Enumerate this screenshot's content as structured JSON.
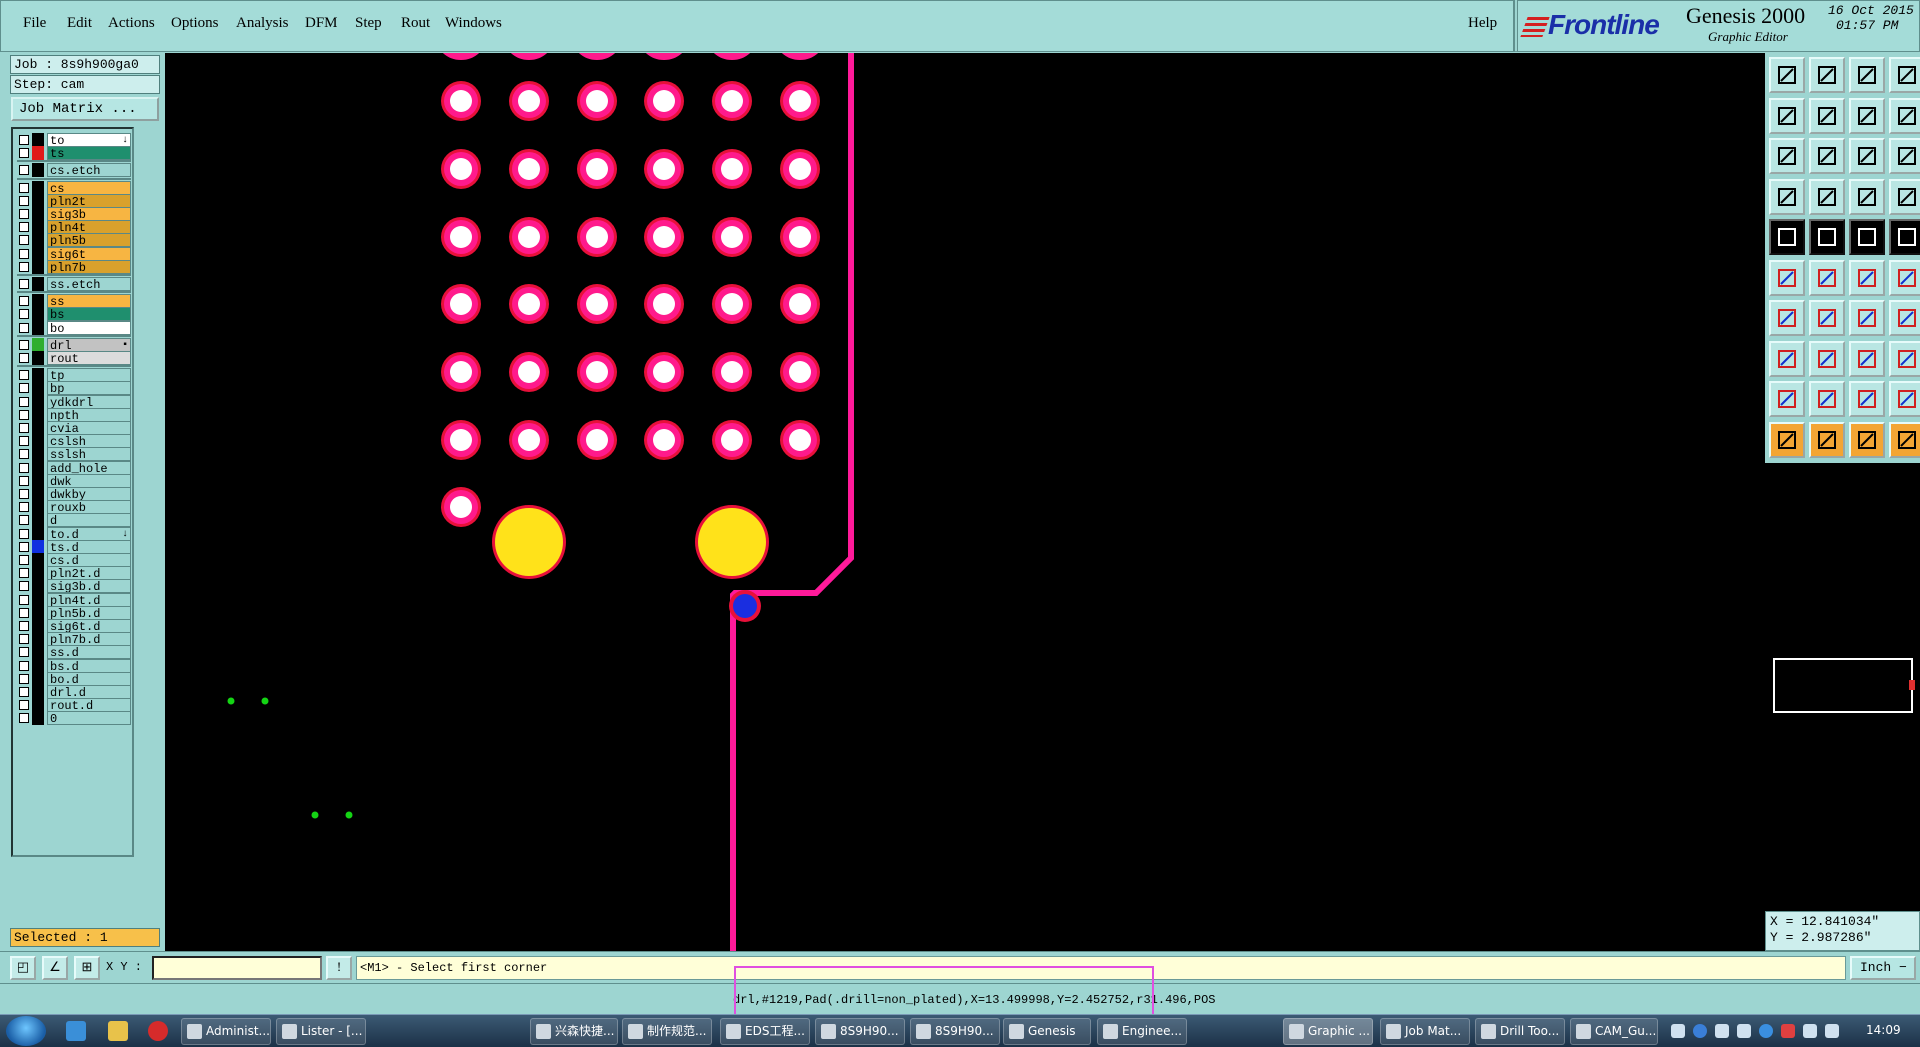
{
  "menubar": {
    "items": [
      "File",
      "Edit",
      "Actions",
      "Options",
      "Analysis",
      "DFM",
      "Step",
      "Rout",
      "Windows"
    ],
    "help": "Help"
  },
  "brand": {
    "logo": "Frontline",
    "product": "Genesis 2000",
    "subtitle": "Graphic Editor",
    "date": "16 Oct 2015",
    "time": "01:57 PM"
  },
  "job": {
    "job": "Job : 8s9h900ga0",
    "step": "Step: cam",
    "matrix_button": "Job Matrix ..."
  },
  "layers": [
    {
      "name": "to",
      "color": "#ffffff",
      "swatch": "#000000",
      "flag": "↓"
    },
    {
      "name": "ts",
      "color": "#1f8f6e",
      "swatch": "#e01a1a",
      "flag": ""
    },
    {
      "name": "cs.etch",
      "color": "#9dd5d1",
      "swatch": "#000000",
      "flag": ""
    },
    {
      "name": "cs",
      "color": "#f7b542",
      "swatch": "#000000",
      "flag": ""
    },
    {
      "name": "pln2t",
      "color": "#d9a12c",
      "swatch": "#000000",
      "flag": ""
    },
    {
      "name": "sig3b",
      "color": "#f7b542",
      "swatch": "#000000",
      "flag": ""
    },
    {
      "name": "pln4t",
      "color": "#d9a12c",
      "swatch": "#000000",
      "flag": ""
    },
    {
      "name": "pln5b",
      "color": "#d9a12c",
      "swatch": "#000000",
      "flag": ""
    },
    {
      "name": "sig6t",
      "color": "#f7b542",
      "swatch": "#000000",
      "flag": ""
    },
    {
      "name": "pln7b",
      "color": "#d9a12c",
      "swatch": "#000000",
      "flag": ""
    },
    {
      "name": "ss.etch",
      "color": "#9dd5d1",
      "swatch": "#000000",
      "flag": ""
    },
    {
      "name": "ss",
      "color": "#f7b542",
      "swatch": "#000000",
      "flag": ""
    },
    {
      "name": "bs",
      "color": "#1f8f6e",
      "swatch": "#000000",
      "flag": ""
    },
    {
      "name": "bo",
      "color": "#ffffff",
      "swatch": "#000000",
      "flag": ""
    },
    {
      "name": "drl",
      "color": "#c2c2c2",
      "swatch": "#2fae2f",
      "flag": "▪"
    },
    {
      "name": "rout",
      "color": "#dcdcdc",
      "swatch": "#000000",
      "flag": ""
    },
    {
      "name": "tp",
      "color": "#9dd5d1",
      "swatch": "#000000",
      "flag": ""
    },
    {
      "name": "bp",
      "color": "#9dd5d1",
      "swatch": "#000000",
      "flag": ""
    },
    {
      "name": "ydkdrl",
      "color": "#9dd5d1",
      "swatch": "#000000",
      "flag": ""
    },
    {
      "name": "npth",
      "color": "#9dd5d1",
      "swatch": "#000000",
      "flag": ""
    },
    {
      "name": "cvia",
      "color": "#9dd5d1",
      "swatch": "#000000",
      "flag": ""
    },
    {
      "name": "cslsh",
      "color": "#9dd5d1",
      "swatch": "#000000",
      "flag": ""
    },
    {
      "name": "sslsh",
      "color": "#9dd5d1",
      "swatch": "#000000",
      "flag": ""
    },
    {
      "name": "add_hole",
      "color": "#9dd5d1",
      "swatch": "#000000",
      "flag": ""
    },
    {
      "name": "dwk",
      "color": "#9dd5d1",
      "swatch": "#000000",
      "flag": ""
    },
    {
      "name": "dwkby",
      "color": "#9dd5d1",
      "swatch": "#000000",
      "flag": ""
    },
    {
      "name": "rouxb",
      "color": "#9dd5d1",
      "swatch": "#000000",
      "flag": ""
    },
    {
      "name": "d",
      "color": "#9dd5d1",
      "swatch": "#000000",
      "flag": ""
    },
    {
      "name": "to.d",
      "color": "#9dd5d1",
      "swatch": "#000000",
      "flag": "↓"
    },
    {
      "name": "ts.d",
      "color": "#9dd5d1",
      "swatch": "#1030e0",
      "flag": ""
    },
    {
      "name": "cs.d",
      "color": "#9dd5d1",
      "swatch": "#000000",
      "flag": ""
    },
    {
      "name": "pln2t.d",
      "color": "#9dd5d1",
      "swatch": "#000000",
      "flag": ""
    },
    {
      "name": "sig3b.d",
      "color": "#9dd5d1",
      "swatch": "#000000",
      "flag": ""
    },
    {
      "name": "pln4t.d",
      "color": "#9dd5d1",
      "swatch": "#000000",
      "flag": ""
    },
    {
      "name": "pln5b.d",
      "color": "#9dd5d1",
      "swatch": "#000000",
      "flag": ""
    },
    {
      "name": "sig6t.d",
      "color": "#9dd5d1",
      "swatch": "#000000",
      "flag": ""
    },
    {
      "name": "pln7b.d",
      "color": "#9dd5d1",
      "swatch": "#000000",
      "flag": ""
    },
    {
      "name": "ss.d",
      "color": "#9dd5d1",
      "swatch": "#000000",
      "flag": ""
    },
    {
      "name": "bs.d",
      "color": "#9dd5d1",
      "swatch": "#000000",
      "flag": ""
    },
    {
      "name": "bo.d",
      "color": "#9dd5d1",
      "swatch": "#000000",
      "flag": ""
    },
    {
      "name": "drl.d",
      "color": "#9dd5d1",
      "swatch": "#000000",
      "flag": ""
    },
    {
      "name": "rout.d",
      "color": "#9dd5d1",
      "swatch": "#000000",
      "flag": ""
    },
    {
      "name": "0",
      "color": "#9dd5d1",
      "swatch": "#000000",
      "flag": ""
    }
  ],
  "selected": "Selected : 1",
  "canvas": {
    "pad_fill": "#ffffff",
    "pad_ring": "#ff1a8c",
    "ring_outer": "#e8103a",
    "big_pad_fill": "#ffe21a",
    "via_fill": "#1a2ee0",
    "trace_color": "#ff1a9a",
    "dot_color": "#14d414"
  },
  "coords": {
    "x": "X = 12.841034\"",
    "y": "Y = 2.987286\""
  },
  "command": {
    "xy_label": "X Y :",
    "xy_value": "",
    "message": "<M1> - Select first corner",
    "units": "Inch"
  },
  "status": {
    "text": "drl,#1219,Pad(.drill=non_plated),X=13.499998,Y=2.452752,r31.496,POS"
  },
  "taskbar": {
    "tasks": [
      "Administ...",
      "Lister - [...",
      "兴森快捷...",
      "制作规范...",
      "EDS工程...",
      "8S9H90...",
      "8S9H90...",
      "Genesis",
      "Enginee...",
      "Graphic ...",
      "Job Mat...",
      "Drill Too...",
      "CAM_Gu..."
    ],
    "active_task": "Graphic ...",
    "clock": "14:09"
  }
}
